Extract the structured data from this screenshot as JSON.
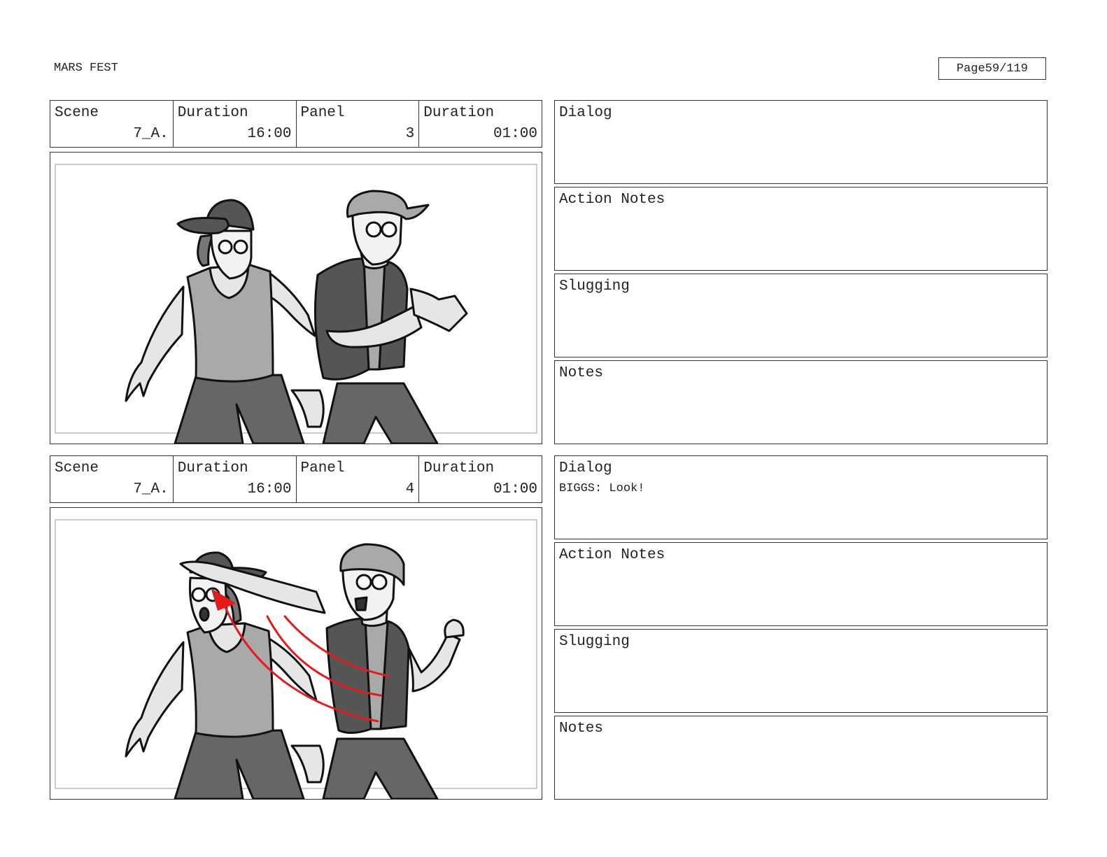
{
  "header": {
    "project_title": "MARS FEST",
    "page_label": "Page",
    "page_number": "59/119"
  },
  "labels": {
    "scene": "Scene",
    "duration": "Duration",
    "panel": "Panel",
    "dialog": "Dialog",
    "action_notes": "Action Notes",
    "slugging": "Slugging",
    "notes": "Notes"
  },
  "panels": [
    {
      "scene": "7_A.",
      "scene_duration": "16:00",
      "panel": "3",
      "panel_duration": "01:00",
      "dialog": "",
      "action_notes": "",
      "slugging": "",
      "notes": ""
    },
    {
      "scene": "7_A.",
      "scene_duration": "16:00",
      "panel": "4",
      "panel_duration": "01:00",
      "dialog": "BIGGS: Look!",
      "action_notes": "",
      "slugging": "",
      "notes": ""
    }
  ],
  "colors": {
    "arrow": "#e31b1b",
    "vest": "#555555",
    "shirt": "#a9a9a9",
    "pants": "#666666",
    "skin": "#e6e6e6"
  }
}
